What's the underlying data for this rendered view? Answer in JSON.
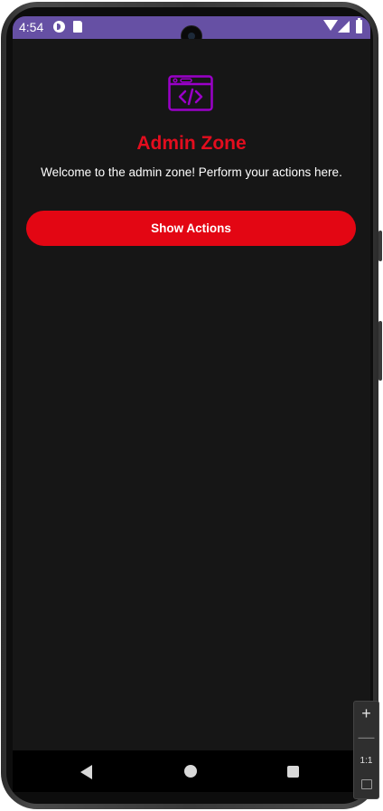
{
  "status_bar": {
    "time": "4:54",
    "icons": [
      "app-notification-icon",
      "sd-card-icon",
      "wifi-icon",
      "signal-icon",
      "battery-icon"
    ]
  },
  "app": {
    "icon": "code-window-icon",
    "title": "Admin Zone",
    "welcome_text": "Welcome to the admin zone! Perform your actions here.",
    "action_button_label": "Show Actions"
  },
  "navigation_bar": {
    "icons": [
      "back-icon",
      "home-icon",
      "recents-icon"
    ]
  },
  "emulator_toolbar": {
    "zoom_in_label": "+",
    "zoom_out_label": "—",
    "actual_size_label": "1:1",
    "fit_icon": "fit-to-window-icon"
  },
  "colors": {
    "status_bar": "#6650a4",
    "background": "#161616",
    "accent_red": "#e30613",
    "title_red": "#e30d1e",
    "icon_purple": "#9a00c8"
  }
}
